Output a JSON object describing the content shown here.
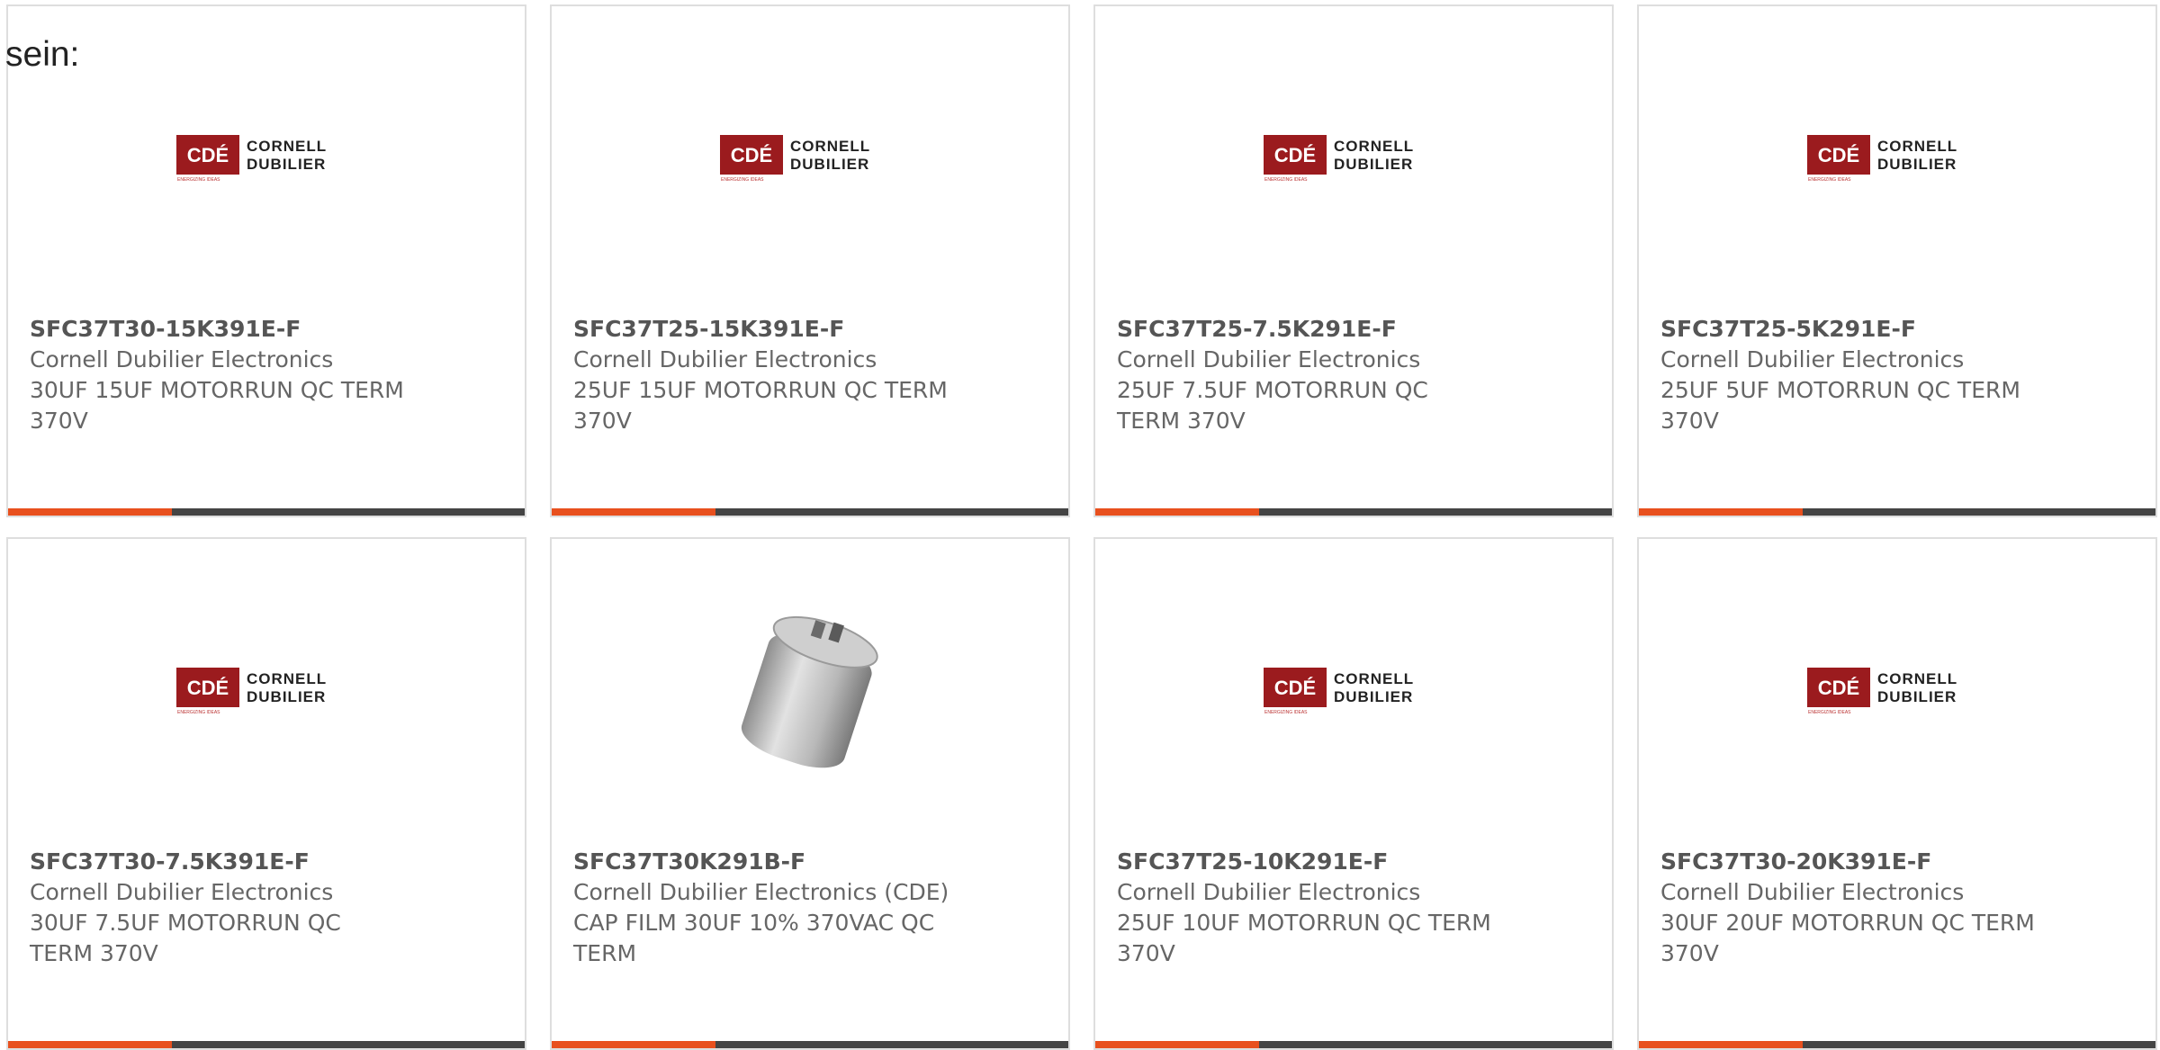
{
  "lead_text": "sein:",
  "colors": {
    "accent": "#e8501e",
    "bar_dark": "#444444",
    "border": "#dedede",
    "text": "#666666",
    "logo_red": "#9b1b1e"
  },
  "logo": {
    "mark": "CDÉ",
    "line1": "CORNELL",
    "line2": "DUBILIER",
    "tagline": "ENERGIZING IDEAS"
  },
  "products": [
    {
      "part": "SFC37T30-15K391E-F",
      "maker": "Cornell Dubilier Electronics",
      "desc1": "30UF 15UF MOTORRUN QC TERM",
      "desc2": "370V",
      "image": "cde-logo"
    },
    {
      "part": "SFC37T25-15K391E-F",
      "maker": "Cornell Dubilier Electronics",
      "desc1": "25UF 15UF MOTORRUN QC TERM",
      "desc2": "370V",
      "image": "cde-logo"
    },
    {
      "part": "SFC37T25-7.5K291E-F",
      "maker": "Cornell Dubilier Electronics",
      "desc1": "25UF 7.5UF MOTORRUN QC",
      "desc2": "TERM 370V",
      "image": "cde-logo"
    },
    {
      "part": "SFC37T25-5K291E-F",
      "maker": "Cornell Dubilier Electronics",
      "desc1": "25UF 5UF MOTORRUN QC TERM",
      "desc2": "370V",
      "image": "cde-logo"
    },
    {
      "part": "SFC37T30-7.5K391E-F",
      "maker": "Cornell Dubilier Electronics",
      "desc1": "30UF 7.5UF MOTORRUN QC",
      "desc2": "TERM 370V",
      "image": "cde-logo"
    },
    {
      "part": "SFC37T30K291B-F",
      "maker": "Cornell Dubilier Electronics (CDE)",
      "desc1": "CAP FILM 30UF 10% 370VAC QC",
      "desc2": "TERM",
      "image": "capacitor-photo"
    },
    {
      "part": "SFC37T25-10K291E-F",
      "maker": "Cornell Dubilier Electronics",
      "desc1": "25UF 10UF MOTORRUN QC TERM",
      "desc2": "370V",
      "image": "cde-logo"
    },
    {
      "part": "SFC37T30-20K391E-F",
      "maker": "Cornell Dubilier Electronics",
      "desc1": "30UF 20UF MOTORRUN QC TERM",
      "desc2": "370V",
      "image": "cde-logo"
    }
  ]
}
